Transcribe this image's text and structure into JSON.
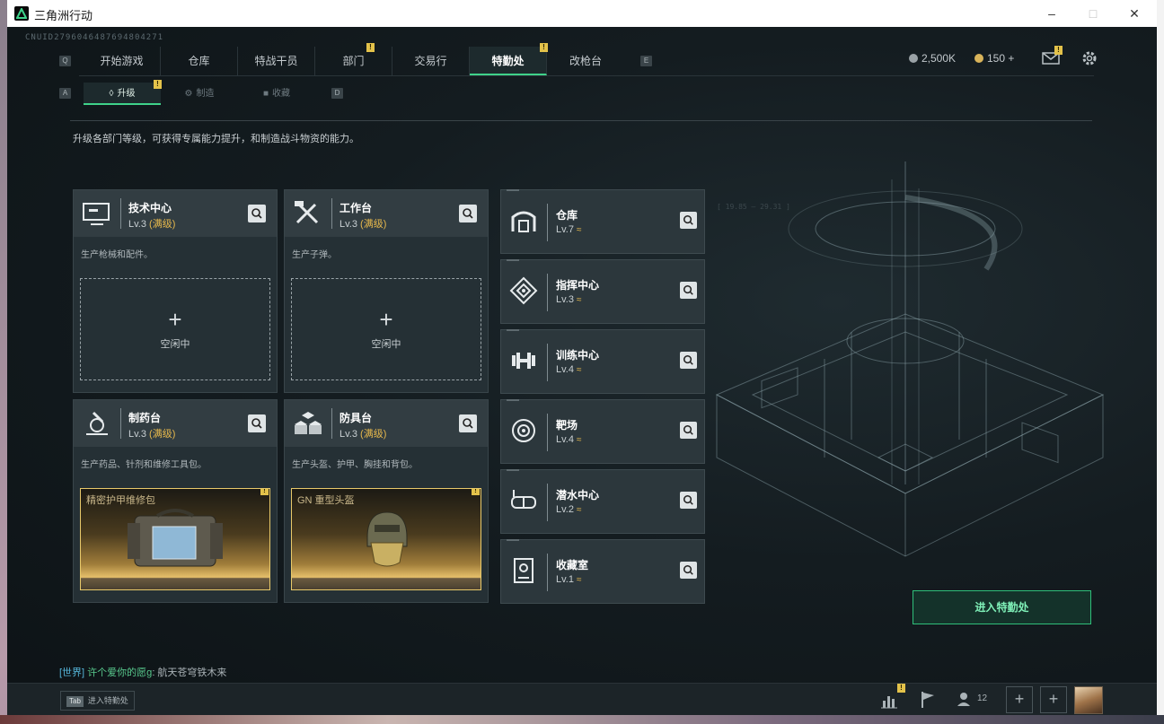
{
  "window": {
    "title": "三角洲行动"
  },
  "uid": "CNUID2796046487694804271",
  "nav": {
    "left_key": "Q",
    "right_key": "E",
    "tabs": [
      {
        "label": "开始游戏",
        "badge": ""
      },
      {
        "label": "仓库",
        "badge": ""
      },
      {
        "label": "特战干员",
        "badge": ""
      },
      {
        "label": "部门",
        "badge": "!"
      },
      {
        "label": "交易行",
        "badge": ""
      },
      {
        "label": "特勤处",
        "badge": "!",
        "active": true
      },
      {
        "label": "改枪台",
        "badge": ""
      }
    ]
  },
  "subnav": {
    "left_key": "A",
    "right_key": "D",
    "tabs": [
      {
        "label": "升级",
        "badge": "!",
        "active": true
      },
      {
        "label": "制造",
        "badge": ""
      },
      {
        "label": "收藏",
        "badge": ""
      }
    ]
  },
  "currency": {
    "coins": "2,500K",
    "tickets": "150",
    "plus": "+"
  },
  "header_badges": {
    "mail": "!"
  },
  "description": "升级各部门等级，可获得专属能力提升，和制造战斗物资的能力。",
  "cards": [
    {
      "name": "技术中心",
      "level": "Lv.3",
      "max": "(满级)",
      "desc": "生产枪械和配件。",
      "slot": "空闲中",
      "icon": "computer-icon"
    },
    {
      "name": "工作台",
      "level": "Lv.3",
      "max": "(满级)",
      "desc": "生产子弹。",
      "slot": "空闲中",
      "icon": "tools-icon"
    },
    {
      "name": "制药台",
      "level": "Lv.3",
      "max": "(满级)",
      "desc": "生产药品、针剂和维修工具包。",
      "product": "精密护甲维修包",
      "icon": "microscope-icon"
    },
    {
      "name": "防具台",
      "level": "Lv.3",
      "max": "(满级)",
      "desc": "生产头盔、护甲、胸挂和背包。",
      "product": "GN 重型头盔",
      "icon": "boxes-icon"
    }
  ],
  "slot_plus": "+",
  "product_badge": "!",
  "facilities": [
    {
      "name": "仓库",
      "level": "Lv.7",
      "icon": "warehouse-icon"
    },
    {
      "name": "指挥中心",
      "level": "Lv.3",
      "icon": "command-icon"
    },
    {
      "name": "训练中心",
      "level": "Lv.4",
      "icon": "dumbbell-icon"
    },
    {
      "name": "靶场",
      "level": "Lv.4",
      "icon": "target-icon"
    },
    {
      "name": "潜水中心",
      "level": "Lv.2",
      "icon": "diving-mask-icon"
    },
    {
      "name": "收藏室",
      "level": "Lv.1",
      "icon": "collection-icon"
    }
  ],
  "upgrade_glyph": "≈",
  "enter_button": "进入特勤处",
  "chat": {
    "channel": "[世界]",
    "user": "许个爱你的愿g",
    "message": ": 航天苍穹铁木来"
  },
  "bottom": {
    "tab_key": "Tab",
    "tab_hint": "进入特勤处",
    "friends": "12",
    "stats_badge": "!",
    "plus": "+"
  },
  "colors": {
    "accent": "#3fd28a",
    "gold": "#e6b84c",
    "badge": "#e3c24a"
  }
}
